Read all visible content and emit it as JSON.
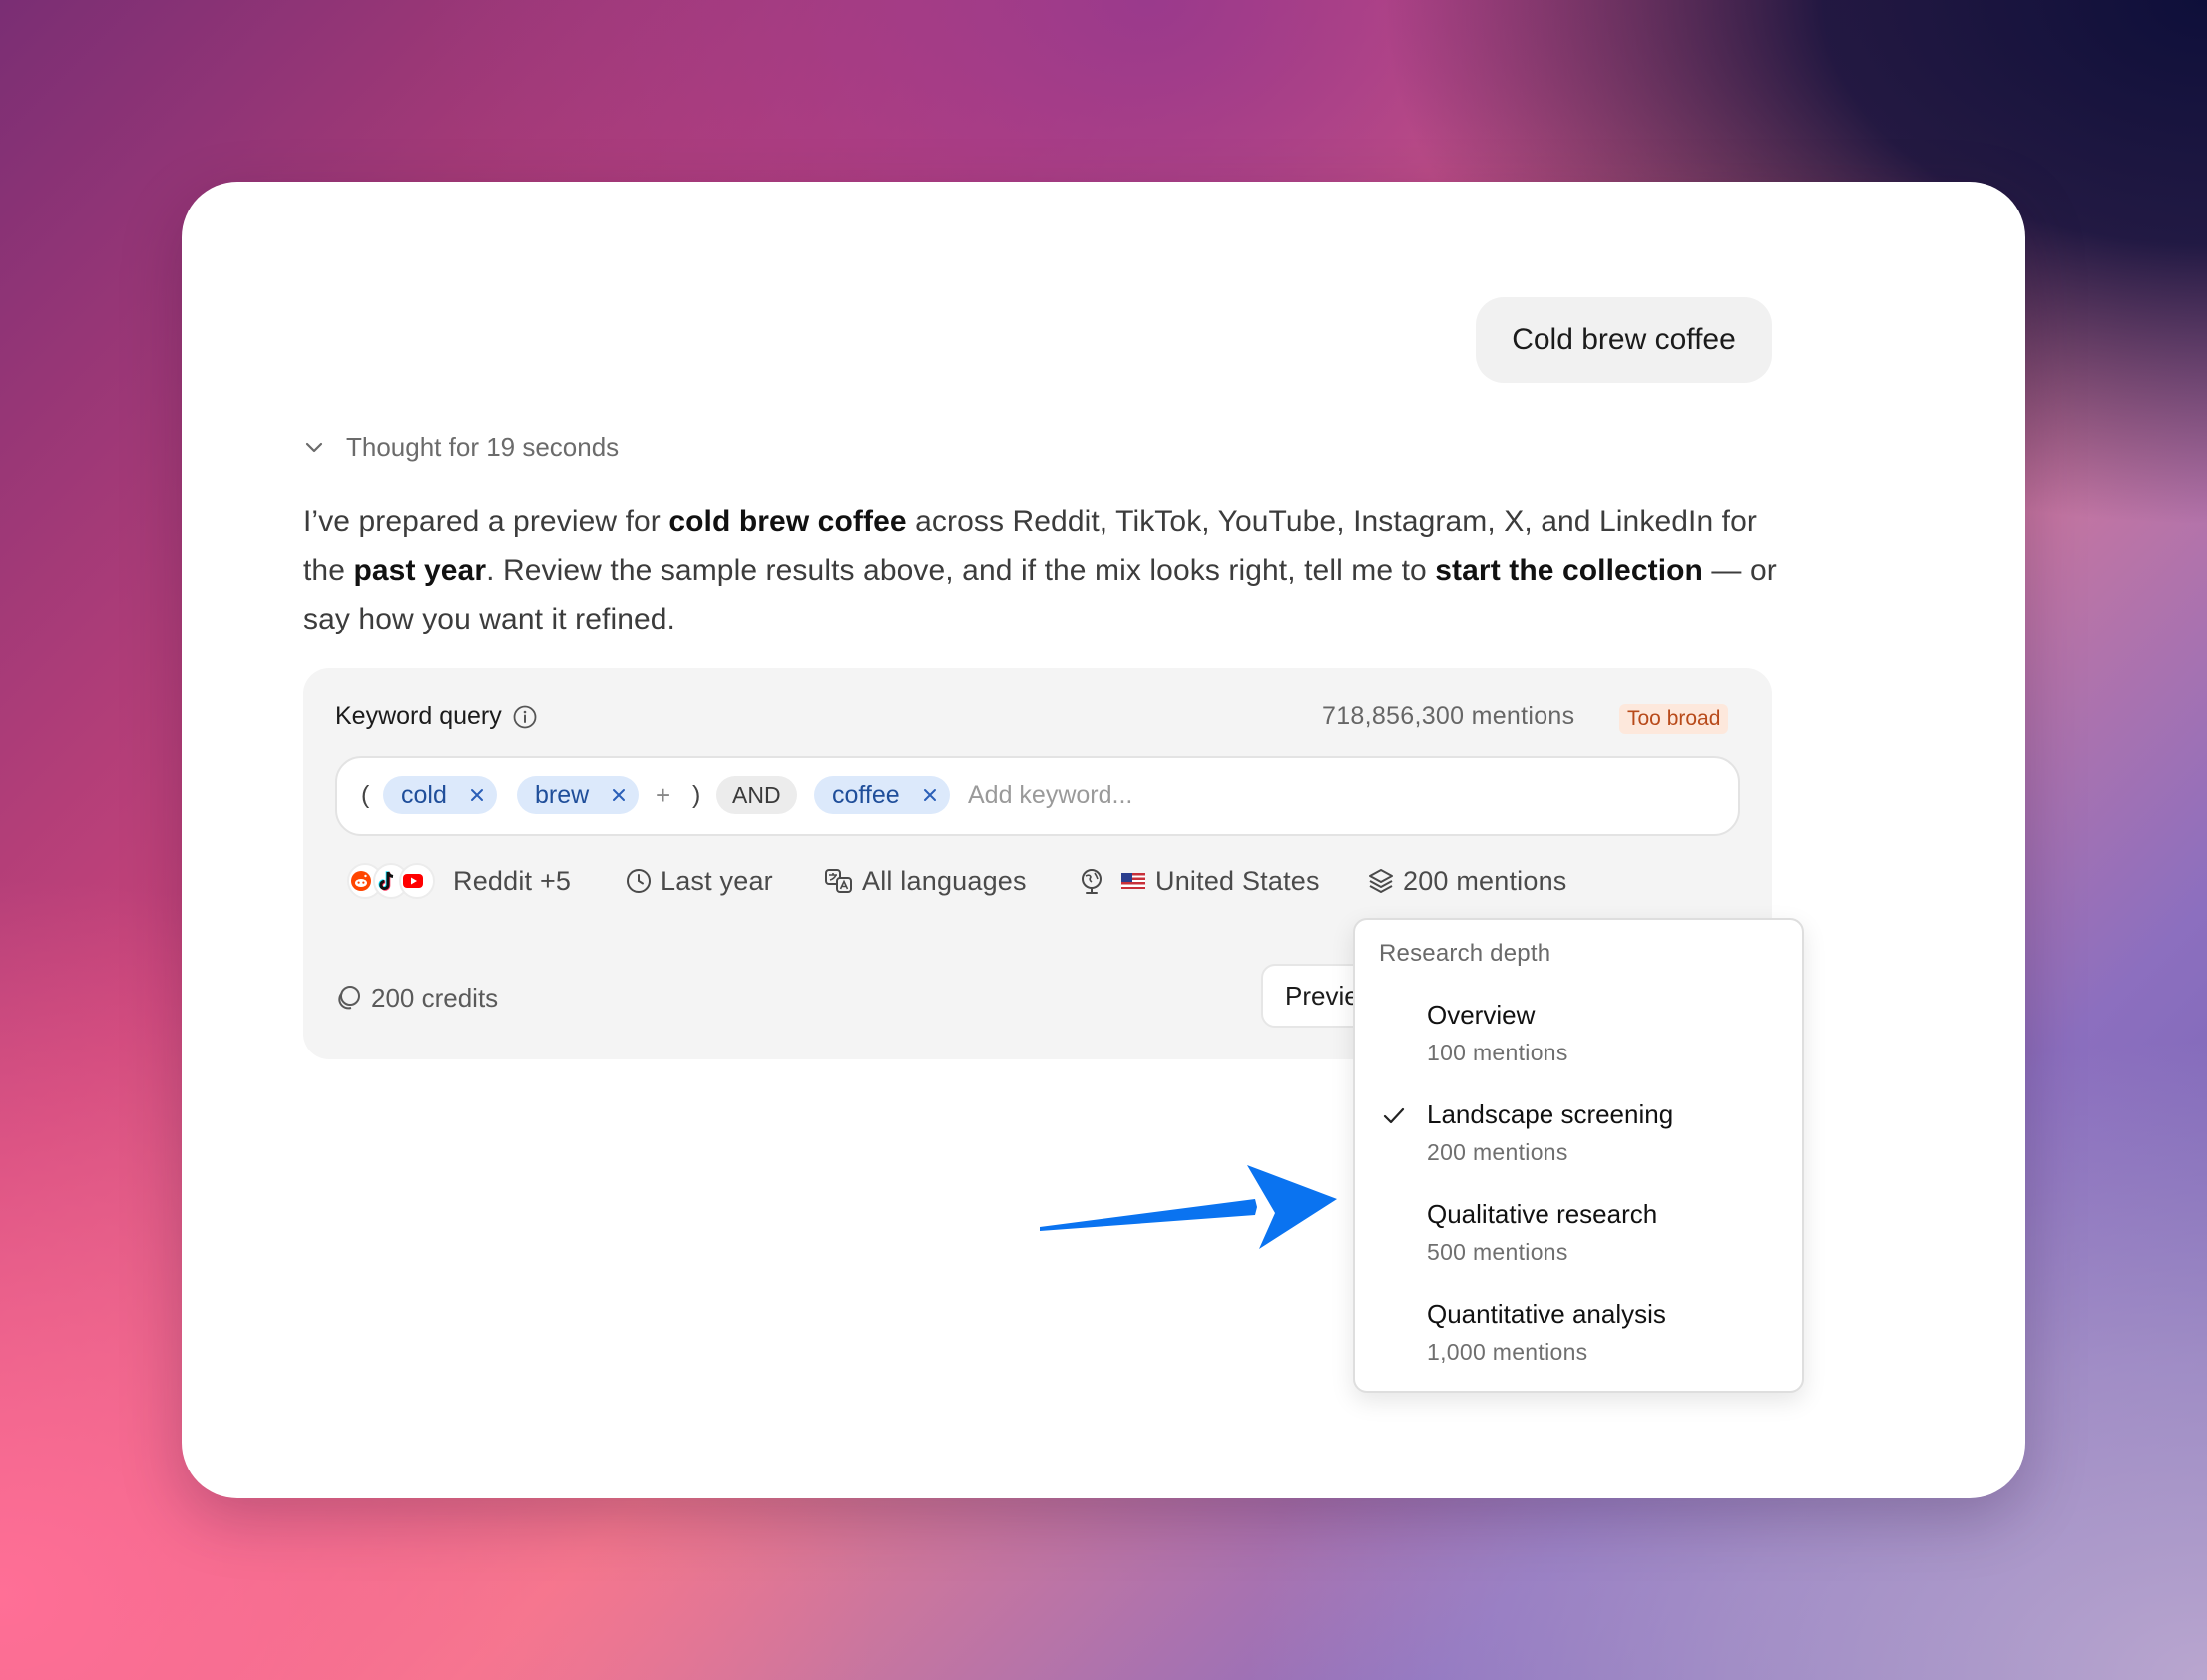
{
  "chat": {
    "user_message": "Cold brew coffee",
    "thought_label": "Thought for 19 seconds",
    "response": {
      "t1": "I’ve prepared a preview for ",
      "b1": "cold brew coffee",
      "t2": " across Reddit, TikTok, YouTube, Instagram, X, and LinkedIn for the ",
      "b2": "past year",
      "t3": ". Review the sample results above, and if the mix looks right, tell me to ",
      "b3": "start the collection",
      "t4": " — or say how you want it refined."
    }
  },
  "query_panel": {
    "title": "Keyword query",
    "mentions_count": "718,856,300 mentions",
    "warning_badge": "Too broad",
    "tokens": {
      "open_paren": "(",
      "chip_cold": "cold",
      "chip_brew": "brew",
      "plus": "+",
      "close_paren": ")",
      "operator": "AND",
      "chip_coffee": "coffee"
    },
    "keyword_placeholder": "Add keyword...",
    "options": {
      "platforms": "Reddit +5",
      "platform_icons": [
        "reddit-icon",
        "tiktok-icon",
        "youtube-icon"
      ],
      "time_range": "Last year",
      "languages": "All languages",
      "location": "United States",
      "depth": "200 mentions"
    },
    "credits": "200 credits",
    "preview_button": "Previe"
  },
  "depth_dropdown": {
    "title": "Research depth",
    "items": [
      {
        "label": "Overview",
        "sub": "100 mentions",
        "selected": false
      },
      {
        "label": "Landscape screening",
        "sub": "200 mentions",
        "selected": true
      },
      {
        "label": "Qualitative research",
        "sub": "500 mentions",
        "selected": false
      },
      {
        "label": "Quantitative analysis",
        "sub": "1,000 mentions",
        "selected": false
      }
    ]
  },
  "colors": {
    "chip_bg": "#dce9fb",
    "chip_text": "#1f4e9a",
    "warning_bg": "#fde8dc",
    "warning_text": "#b84a1a",
    "annotation_arrow": "#0a73f0"
  }
}
